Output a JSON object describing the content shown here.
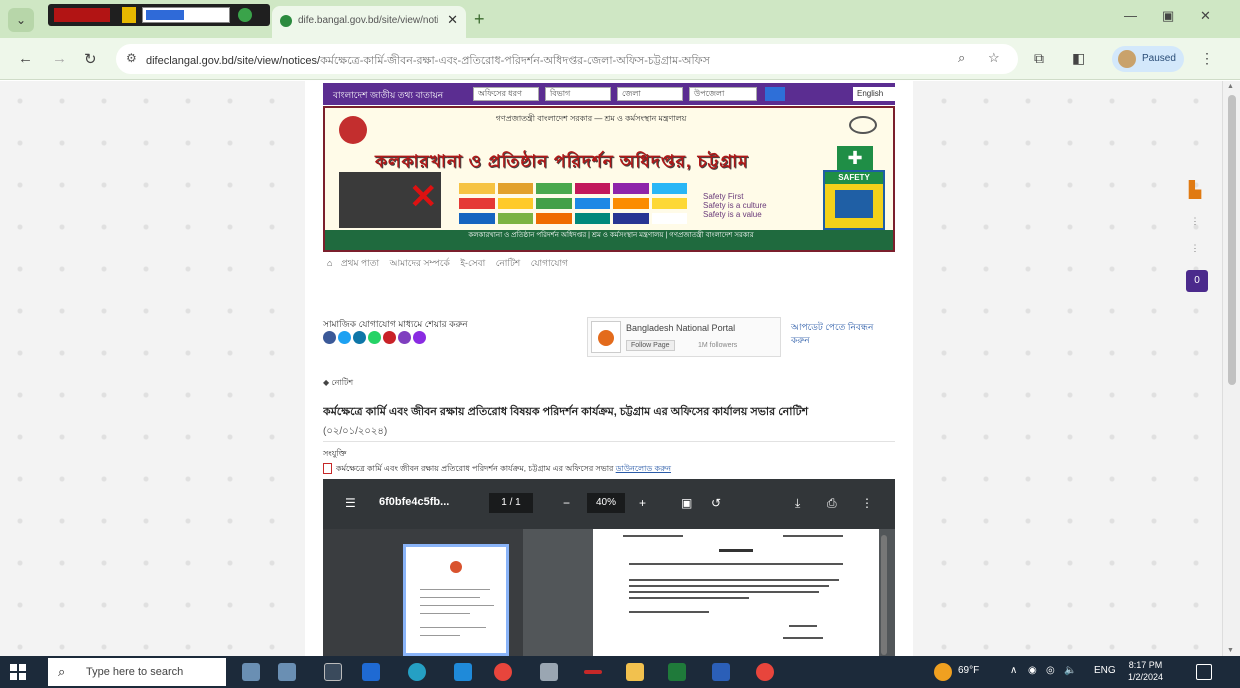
{
  "browser": {
    "tab_title": "dife.bangal.gov.bd/site/view/notices",
    "url_host": "difeclangal.gov.bd/site/view/notices/",
    "url_path": "কর্মক্ষেত্রে-কার্মি-জীবন-রক্ষা-এবং-প্রতিরোধ-পরিদর্শন-অধিদপ্তর-জেলা-অফিস-চট্টগ্রাম-অফিস",
    "profile_label": "Paused"
  },
  "site": {
    "topnav_label": "বাংলাদেশ জাতীয় তথ্য বাতায়ন",
    "selects": [
      "অফিসের ধরণ",
      "বিভাগ",
      "জেলা",
      "উপজেলা"
    ],
    "lang": "English",
    "banner_lines": "গণপ্রজাতন্ত্রী বাংলাদেশ সরকার — শ্রম ও কর্মসংস্থান মন্ত্রণালয়",
    "banner_title": "কলকারখানা ও প্রতিষ্ঠান পরিদর্শন অধিদপ্তর, চট্টগ্রাম",
    "slogan_1": "Safety First",
    "slogan_2": "Safety is a culture",
    "slogan_3": "Safety is a value",
    "safety_label": "SAFETY",
    "footer_line": "কলকারখানা ও প্রতিষ্ঠান পরিদর্শন অধিদপ্তর | শ্রম ও কর্মসংস্থান মন্ত্রণালয় | গণপ্রজাতন্ত্রী বাংলাদেশ সরকার",
    "breadcrumb": [
      "প্রথম পাতা",
      "আমাদের সম্পর্কে",
      "ই-সেবা",
      "নোটিশ",
      "যোগাযোগ"
    ],
    "share_label": "সামাজিক যোগাযোগ মাধ্যমে শেয়ার করুন",
    "share_colors": [
      "#3b5998",
      "#1da1f2",
      "#0e76a8",
      "#25d366",
      "#c92228",
      "#7f3fbf",
      "#8a2be2"
    ],
    "fb_name": "Bangladesh National Portal",
    "fb_follow": "Follow Page",
    "fb_count": "1M followers",
    "subscribe": "আপডেট পেতে নিবন্ধন করুন"
  },
  "notice": {
    "section": "নোটিশ",
    "title": "কর্মক্ষেত্রে কার্মি এবং জীবন রক্ষায় প্রতিরোধ বিষয়ক পরিদর্শন কার্যক্রম, চট্টগ্রাম এর অফিসের কার্যালয় সভার নোটিশ",
    "date": "(০২/০১/২০২৪)",
    "attach_label": "সংযুক্তি",
    "attach_text": "কর্মক্ষেত্রে কার্মি এবং জীবন রক্ষায় প্রতিরোধ পরিদর্শন কার্যক্রম, চট্টগ্রাম এর অফিসের সভার",
    "attach_link": "ডাউনলোড করুন"
  },
  "pdf": {
    "filename": "6f0bfe4c5fb...",
    "page": "1 / 1",
    "zoom": "40%"
  },
  "taskbar": {
    "search_placeholder": "Type here to search",
    "weather": "69°F",
    "lang": "ENG",
    "time": "8:17 PM",
    "date": "1/2/2024"
  }
}
